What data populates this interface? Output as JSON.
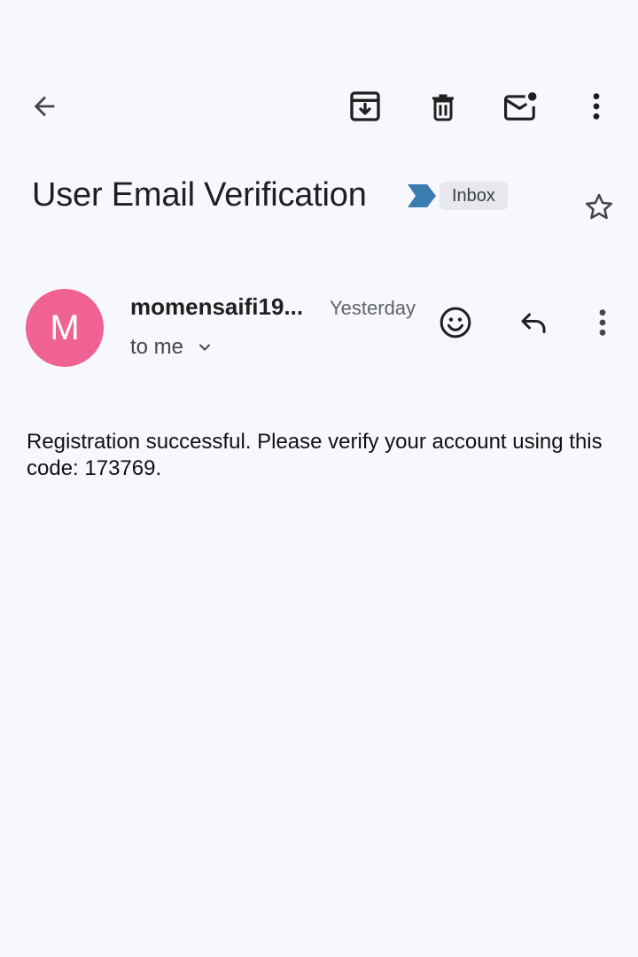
{
  "toolbar": {
    "back_icon": "arrow-left-icon",
    "archive_icon": "archive-icon",
    "delete_icon": "trash-icon",
    "unread_icon": "mark-unread-icon",
    "more_icon": "more-vert-icon"
  },
  "message": {
    "subject": "User Email Verification",
    "label": "Inbox",
    "importance_color": "#3a7bb0",
    "starred": false
  },
  "sender": {
    "initial": "M",
    "avatar_color": "#f06292",
    "name": "momensaifi19...",
    "time": "Yesterday",
    "recipient": "to me"
  },
  "body": {
    "text": "Registration successful. Please verify your account using this code: 173769."
  }
}
